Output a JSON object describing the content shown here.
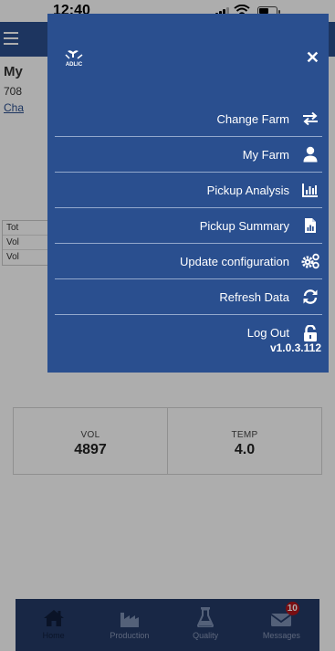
{
  "status": {
    "time": "12:40"
  },
  "background": {
    "farm_title": "My",
    "farm_number": "708",
    "change_link": "Cha",
    "table_rows": [
      "Tot",
      "Vol",
      "Vol"
    ],
    "metrics": [
      {
        "label": "VOL",
        "value": "4897"
      },
      {
        "label": "TEMP",
        "value": "4.0"
      }
    ]
  },
  "drawer": {
    "logo_text": "ADLIC",
    "items": [
      {
        "label": "Change Farm",
        "icon": "swap-arrows-icon"
      },
      {
        "label": "My Farm",
        "icon": "user-icon"
      },
      {
        "label": "Pickup Analysis",
        "icon": "bar-chart-icon"
      },
      {
        "label": "Pickup Summary",
        "icon": "document-chart-icon"
      },
      {
        "label": "Update configuration",
        "icon": "cogs-icon"
      },
      {
        "label": "Refresh Data",
        "icon": "refresh-icon"
      },
      {
        "label": "Log Out",
        "icon": "unlock-icon"
      }
    ],
    "version": "v1.0.3.112"
  },
  "bottom_nav": {
    "items": [
      {
        "label": "Home",
        "icon": "home-icon"
      },
      {
        "label": "Production",
        "icon": "factory-icon"
      },
      {
        "label": "Quality",
        "icon": "flask-icon"
      },
      {
        "label": "Messages",
        "icon": "envelope-icon"
      }
    ],
    "messages_badge": "10"
  },
  "colors": {
    "drawer": "#2a4f8f",
    "header": "#2b4f8e",
    "nav": "#243a66",
    "badge": "#b3151b"
  }
}
